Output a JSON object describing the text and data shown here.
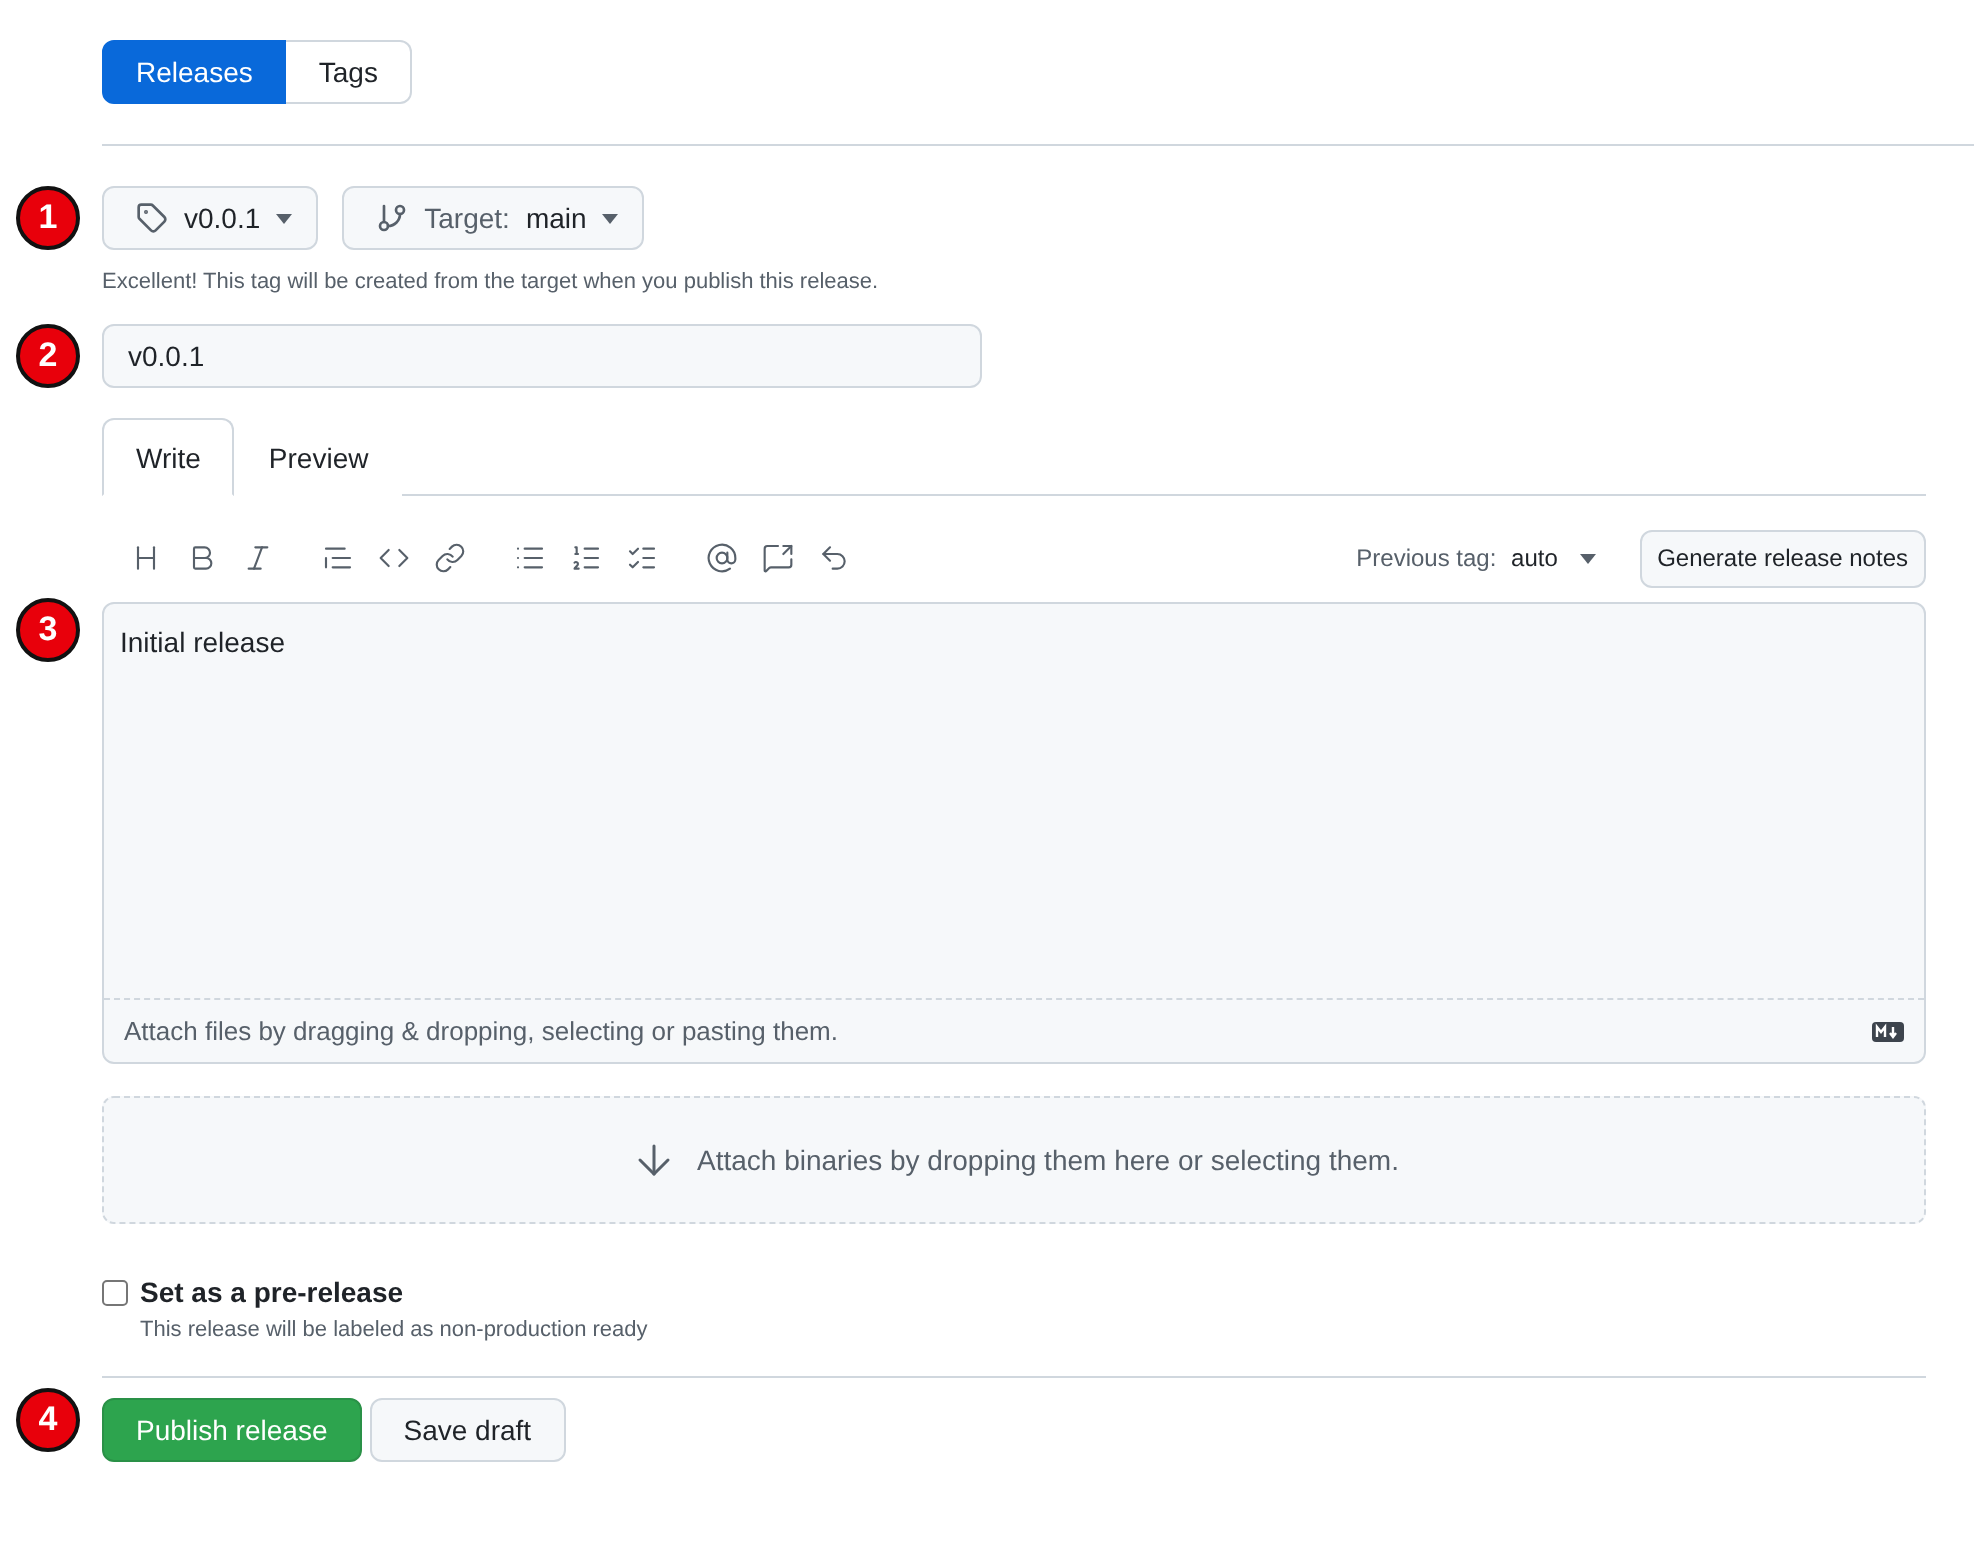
{
  "nav_tabs": [
    {
      "label": "Releases",
      "selected": true
    },
    {
      "label": "Tags",
      "selected": false
    }
  ],
  "steps": [
    "1",
    "2",
    "3",
    "4"
  ],
  "tag_picker": {
    "label": "v0.0.1"
  },
  "target_picker": {
    "label": "Target:",
    "value": "main"
  },
  "tag_hint": "Excellent! This tag will be created from the target when you publish this release.",
  "title_field": {
    "value": "v0.0.1"
  },
  "editor_tabs": [
    {
      "label": "Write",
      "selected": true
    },
    {
      "label": "Preview",
      "selected": false
    }
  ],
  "previous_tag": {
    "label": "Previous tag:",
    "value": "auto"
  },
  "generate_button": "Generate release notes",
  "body": "Initial release",
  "attach_hint": "Attach files by dragging & dropping, selecting or pasting them.",
  "dropzone": "Attach binaries by dropping them here or selecting them.",
  "prerelease": {
    "label": "Set as a pre-release",
    "checked": false,
    "description": "This release will be labeled as non-production ready"
  },
  "actions": [
    {
      "label": "Publish release",
      "kind": "primary"
    },
    {
      "label": "Save draft",
      "kind": "secondary"
    }
  ]
}
